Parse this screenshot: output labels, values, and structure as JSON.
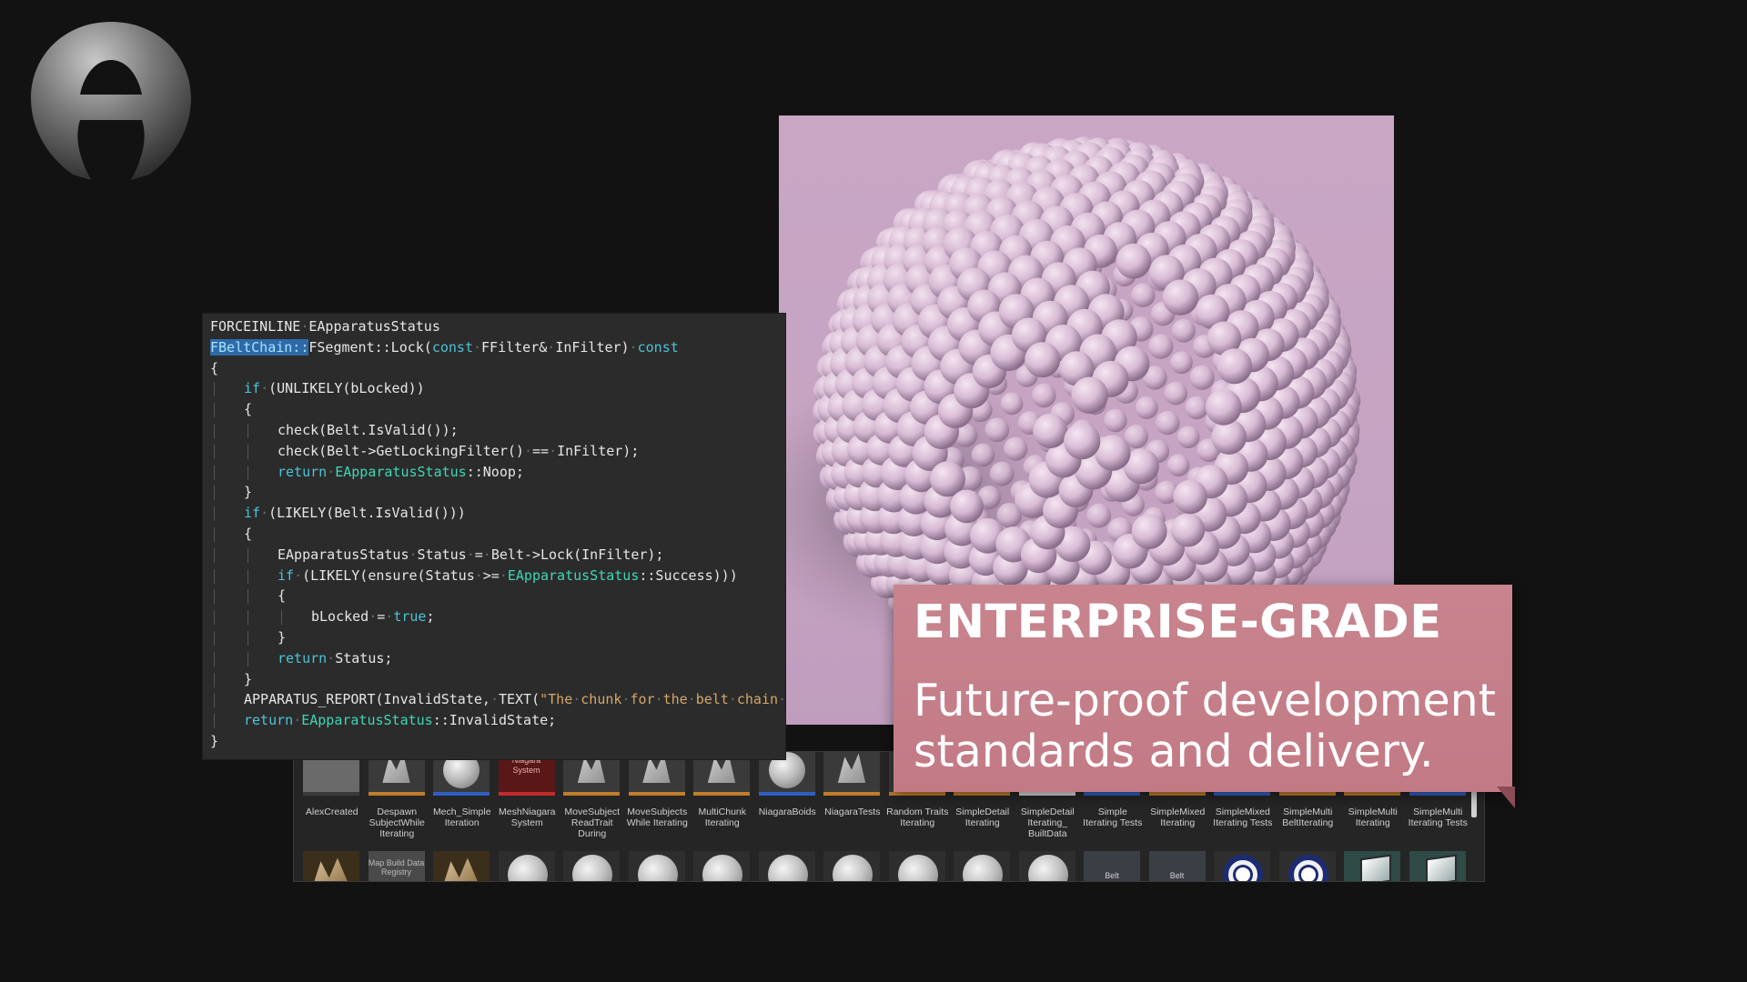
{
  "code": {
    "lines": [
      "FORCEINLINE·EApparatusStatus",
      "FBeltChain::FSegment::Lock(const·FFilter&·InFilter)·const",
      "{",
      "if·(UNLIKELY(bLocked))",
      "{",
      "check(Belt.IsValid());",
      "check(Belt->GetLockingFilter()·==·InFilter);",
      "return·EApparatusStatus::Noop;",
      "}",
      "if·(LIKELY(Belt.IsValid()))",
      "{",
      "EApparatusStatus·Status·=·Belt->Lock(InFilter);",
      "if·(LIKELY(ensure(Status·>=·EApparatusStatus::Success)))",
      "{",
      "bLocked·=·true;",
      "}",
      "return·Status;",
      "}",
      "APPARATUS_REPORT(InvalidState,·TEXT(\"The·chunk·for·the·belt·chain·segment·is·",
      "return·EApparatusStatus::InvalidState;",
      "}"
    ]
  },
  "banner": {
    "heading": "ENTERPRISE-GRADE",
    "subtitle_line1": "Future-proof development",
    "subtitle_line2": "standards and delivery."
  },
  "assets_row1": [
    {
      "label": "AlexCreated",
      "icon": "blank-thumb"
    },
    {
      "label": "Despawn SubjectWhile Iterating",
      "icon": "mesh-thumb"
    },
    {
      "label": "Mech_Simple Iteration",
      "icon": "sphere-thumb"
    },
    {
      "label": "MeshNiagara System",
      "icon": "niagara-thumb",
      "inner": "Niagara System"
    },
    {
      "label": "MoveSubject ReadTrait During",
      "icon": "mesh-thumb"
    },
    {
      "label": "MoveSubjects While Iterating",
      "icon": "mesh-thumb"
    },
    {
      "label": "MultiChunk Iterating",
      "icon": "mesh-thumb"
    },
    {
      "label": "NiagaraBoids",
      "icon": "sphere-thumb"
    },
    {
      "label": "NiagaraTests",
      "icon": "mesh-thumb"
    },
    {
      "label": "Random Traits Iterating",
      "icon": "mesh-thumb"
    },
    {
      "label": "SimpleDetail Iterating",
      "icon": "mesh-thumb"
    },
    {
      "label": "SimpleDetail Iterating_ BuiltData",
      "icon": "data-thumb"
    },
    {
      "label": "Simple Iterating Tests",
      "icon": "sphere-thumb"
    },
    {
      "label": "SimpleMixed Iterating",
      "icon": "mesh-thumb"
    },
    {
      "label": "SimpleMixed Iterating Tests",
      "icon": "sphere-thumb"
    },
    {
      "label": "SimpleMulti BeltIterating",
      "icon": "mesh-thumb"
    },
    {
      "label": "SimpleMulti Iterating",
      "icon": "mesh-thumb"
    },
    {
      "label": "SimpleMulti Iterating Tests",
      "icon": "sphere-thumb"
    }
  ],
  "assets_row2": [
    {
      "icon": "material-thumb"
    },
    {
      "icon": "text-thumb",
      "inner": "Map Build Data Registry"
    },
    {
      "icon": "material-thumb"
    },
    {
      "icon": "sphere-thumb"
    },
    {
      "icon": "sphere-thumb"
    },
    {
      "icon": "sphere-thumb"
    },
    {
      "icon": "sphere-thumb"
    },
    {
      "icon": "sphere-thumb"
    },
    {
      "icon": "sphere-thumb"
    },
    {
      "icon": "sphere-thumb"
    },
    {
      "icon": "sphere-thumb"
    },
    {
      "icon": "sphere-thumb"
    },
    {
      "icon": "belt-thumb",
      "inner": "Belt"
    },
    {
      "icon": "belt-thumb",
      "inner": "Belt"
    },
    {
      "icon": "ring-thumb"
    },
    {
      "icon": "ring-thumb"
    },
    {
      "icon": "cube-thumb"
    },
    {
      "icon": "cube-thumb"
    }
  ],
  "colors": {
    "background": "#121212",
    "banner": "#c8848e",
    "render_bg": "#c8a6c4",
    "code_bg": "#2b2b2b",
    "keyword": "#4cc3d8",
    "type": "#3fd6b5"
  }
}
